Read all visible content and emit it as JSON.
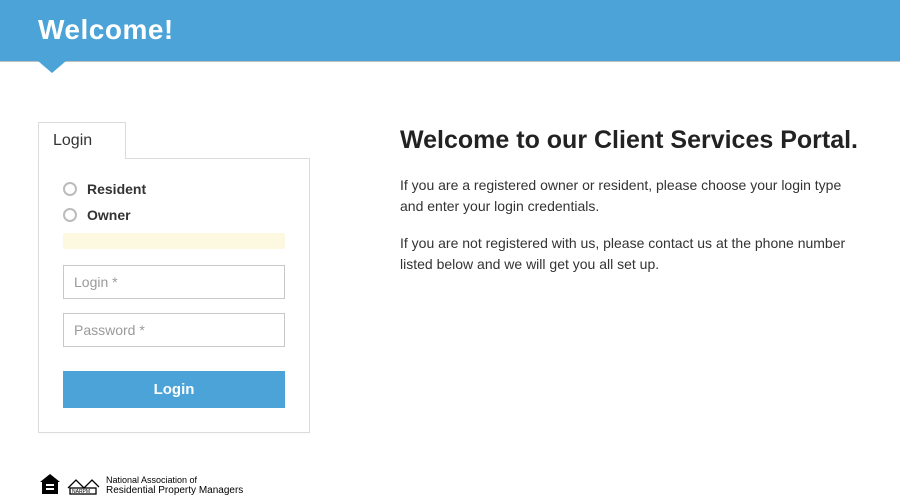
{
  "header": {
    "title": "Welcome!"
  },
  "login": {
    "tab": "Login",
    "options": [
      {
        "label": "Resident"
      },
      {
        "label": "Owner"
      }
    ],
    "login_placeholder": "Login *",
    "password_placeholder": "Password *",
    "button": "Login"
  },
  "main": {
    "heading": "Welcome to our Client Services Portal.",
    "p1": "If you are a registered owner or resident, please choose your login type and enter your login credentials.",
    "p2": "If you are not registered with us, please contact us at the phone number listed below and we will get you all set up."
  },
  "footer": {
    "narpm_line1": "National Association of",
    "narpm_line2": "Residential Property Managers"
  }
}
